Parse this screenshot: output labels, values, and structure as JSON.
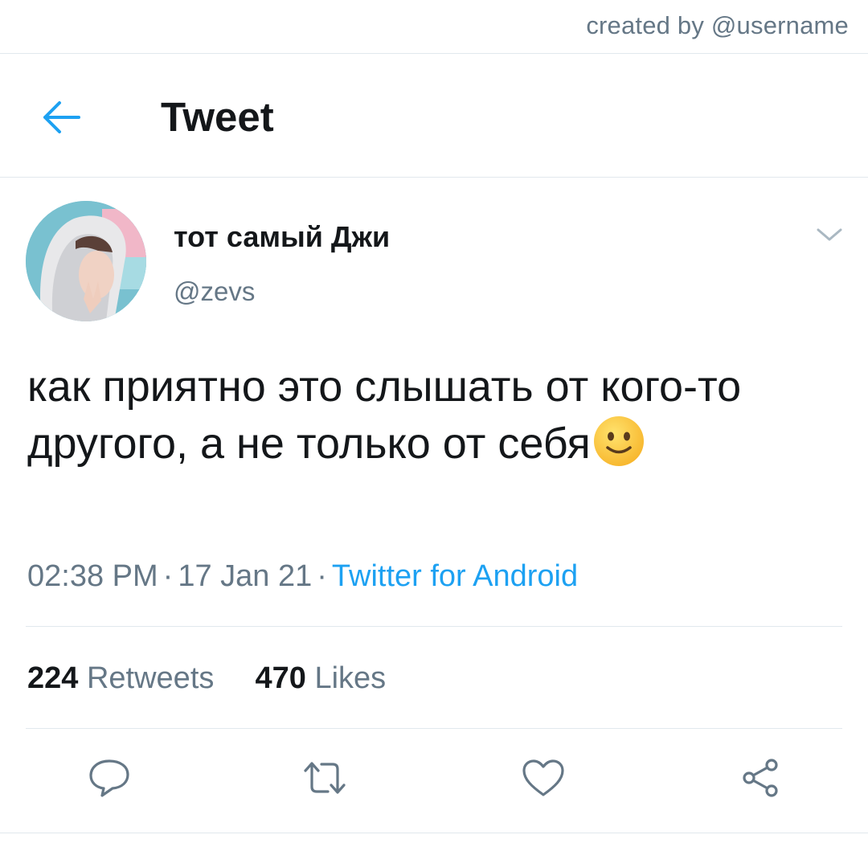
{
  "watermark": "created by @username",
  "header": {
    "title": "Tweet"
  },
  "tweet": {
    "display_name": "тот самый Джи",
    "handle": "@zevs",
    "text": "как приятно это слышать от кого-то другого, а не только от себя",
    "time": "02:38 PM",
    "date": "17 Jan 21",
    "separator": "·",
    "source": "Twitter for Android",
    "retweets_count": "224",
    "retweets_label": "Retweets",
    "likes_count": "470",
    "likes_label": "Likes"
  },
  "icons": {
    "back": "arrow-left-icon",
    "more": "chevron-down-icon",
    "emoji": "slightly-smiling-face-emoji",
    "reply": "reply-bubble-icon",
    "retweet": "retweet-icon",
    "like": "heart-icon",
    "share": "share-icon"
  },
  "colors": {
    "accent": "#1da1f2",
    "text": "#14171a",
    "secondary": "#657786",
    "divider": "#e1e8ed"
  }
}
